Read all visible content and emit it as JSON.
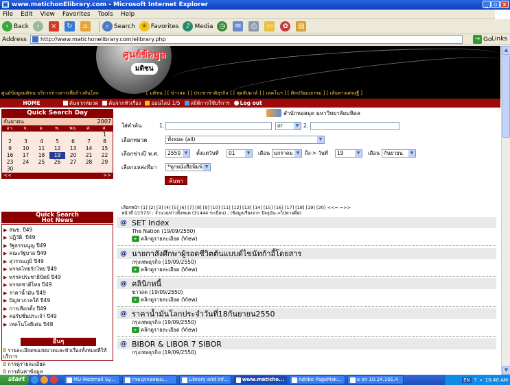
{
  "window": {
    "title": "www.matichonElibrary.com - Microsoft Internet Explorer"
  },
  "menu": [
    "File",
    "Edit",
    "View",
    "Favorites",
    "Tools",
    "Help"
  ],
  "toolbar": {
    "back": "Back",
    "search": "Search",
    "favorites": "Favorites",
    "media": "Media"
  },
  "address": {
    "label": "Address",
    "url": "http://www.matichonelibrary.com/elibrary.php",
    "go": "Go",
    "links": "Links"
  },
  "banner": {
    "logo_th": "ศูนย์ข้อมูล",
    "logo_mc": "มติชน",
    "tagline": "ศูนย์ข้อมูลมติชน บริการข่าวสารเพื่อก้าวทันโลก",
    "categories": "[ มติชน ] [ ข่าวสด ] [ ประชาชาติธุรกิจ ] [ สุดสัปดาห์ ] [ เทคโนฯ ] [ ศิลปวัฒนธรรม ] [ เส้นทางเศรษฐี ]"
  },
  "nav": {
    "home": "HOME",
    "items": [
      "ค้นจากหมวด",
      "ค้นจากหัวเรื่อง",
      "ออนไลน์ 1/5",
      "สถิติการใช้บริการ",
      "Log out"
    ]
  },
  "calendar": {
    "header": "Quick Search Day",
    "month": "กันยายน",
    "year": "2007",
    "dow": [
      "อา.",
      "จ.",
      "อ.",
      "พ.",
      "พฤ.",
      "ศ.",
      "ส."
    ],
    "days": [
      "",
      "",
      "",
      "",
      "",
      "",
      "1",
      "2",
      "3",
      "4",
      "5",
      "6",
      "7",
      "8",
      "9",
      "10",
      "11",
      "12",
      "13",
      "14",
      "15",
      "16",
      "17",
      "18",
      "19",
      "20",
      "21",
      "22",
      "23",
      "24",
      "25",
      "26",
      "27",
      "28",
      "29",
      "30",
      "",
      "",
      "",
      "",
      "",
      ""
    ],
    "today": "19",
    "prev": "<<",
    "next": ">>"
  },
  "quick_search": {
    "title": "Quick Search",
    "subtitle": "Hot News",
    "items": [
      "สนช. ปี49",
      "ปฏิวัติ. ปี49",
      "รัฐธรรมนูญ ปี49",
      "คณะรัฐบาล ปี49",
      "สุวรรณภูมิ ปี49",
      "พรรคไทยรักไทย ปี49",
      "พรรคประชาธิปัตย์ ปี49",
      "พรรคชาติไทย ปี49",
      "ราคาน้ำมัน ปี49",
      "ปัญหาภาคใต้ ปี49",
      "การเลือกตั้ง ปี49",
      "คอรัปชั่นประเจ้า ปี49",
      "เทคโนโลยีเด่น ปี48"
    ]
  },
  "other": {
    "title": "อื่นๆ",
    "items": [
      "รายละเอียดของหมวดและหัวเรื่องทั้งหมดที่ให้บริการ",
      "การดูรายละเอียด",
      "การค้นหาข้อมูล"
    ]
  },
  "office": "สำนักหอสมุด มหาวิทยาลัยมหิดล",
  "form": {
    "keyword_label": "ใส่คำค้น",
    "keyword_prefix": "1.",
    "operator": "or",
    "keyword2_prefix": "2.",
    "category_label": "เลือกหมวด",
    "category_value": "ทั้งหมด (all)",
    "date_label": "เลือกช่วงปี พ.ศ.",
    "year_value": "2550",
    "start_label": "ตั้งแต่วันที่",
    "start_day": "01",
    "month_label": "เดือน",
    "start_month": "มกราคม",
    "to_label": "ถึง-> วันที่",
    "end_day": "19",
    "end_month_label": "เดือน",
    "end_month": "กันยายน",
    "source_label": "เลือกแหล่งที่มา",
    "source_value": "*ทุกหนังสือพิมพ์",
    "search_button": "ค้นหา"
  },
  "pager": {
    "line1": "เลือกหน้า [1] [2] [3] [4] [5] [6] [7] [8] [9] [10] [11] [12] [13] [14] [15] [16] [17] [18] [19] [20]  <<=  =>>",
    "line2": "หน้าที่ (/1573) ; จำนวนข่าวทั้งหมด (31444 ระเบียน) ; (ข้อมูลเรียงจาก ปัจจุบัน->ไปหาอดีต)"
  },
  "results": [
    {
      "title": "SET Index",
      "source": "The Nation (19/09/2550)",
      "detail": "คลิกดูรายละเอียด (View)"
    },
    {
      "title": "นายกาสังศึกษาผู้รอดชีวิตต้นแบบด์ไขนัทก้าอี้โดยสาร",
      "source": "กรุงเทพธุรกิจ (19/09/2550)",
      "detail": "คลิกดูรายละเอียด (View)"
    },
    {
      "title": "คลินิกหนี้",
      "source": "ข่าวสด (19/09/2550)",
      "detail": "คลิกดูรายละเอียด (View)"
    },
    {
      "title": "ราคาน้ำมันโลกประจำวันที่18กันยายน2550",
      "source": "กรุงเทพธุรกิจ (19/09/2550)",
      "detail": "คลิกดูรายละเอียด (View)"
    },
    {
      "title": "BIBOR & LIBOR 7 SIBOR",
      "source": "กรุงเทพธุรกิจ (19/09/2550)",
      "detail": ""
    }
  ],
  "taskbar": {
    "start": "start",
    "tasks": [
      "MU-Webmail Sy...",
      "กรมปุกกอทฒม...",
      "Library and Inf...",
      "www.maticho...",
      "Adobe PageMak...",
      "e on 10.24.101.4"
    ],
    "active_index": 3,
    "lang": "EN",
    "time": "10:40 AM"
  }
}
